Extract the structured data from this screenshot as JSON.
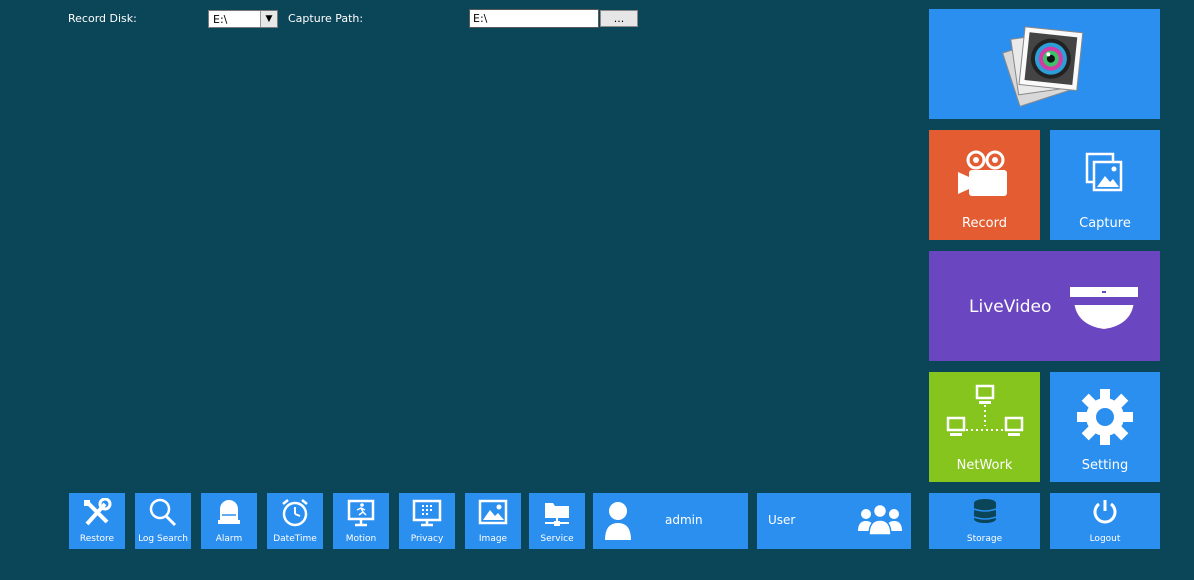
{
  "top": {
    "record_disk_label": "Record Disk:",
    "record_disk_value": "E:\\",
    "capture_path_label": "Capture Path:",
    "capture_path_value": "E:\\",
    "browse_label": "..."
  },
  "tiles": {
    "record": "Record",
    "capture": "Capture",
    "livevideo": "LiveVideo",
    "network": "NetWork",
    "setting": "Setting",
    "storage": "Storage",
    "logout": "Logout"
  },
  "bottom_bar": {
    "restore": "Restore",
    "log_search": "Log Search",
    "alarm": "Alarm",
    "datetime": "DateTime",
    "motion": "Motion",
    "privacy": "Privacy",
    "image": "Image",
    "service": "Service",
    "admin": "admin",
    "user": "User"
  },
  "colors": {
    "background": "#0b4558",
    "blue": "#2b8ff0",
    "orange": "#e35c32",
    "purple": "#6a46c0",
    "green": "#86c51d"
  }
}
